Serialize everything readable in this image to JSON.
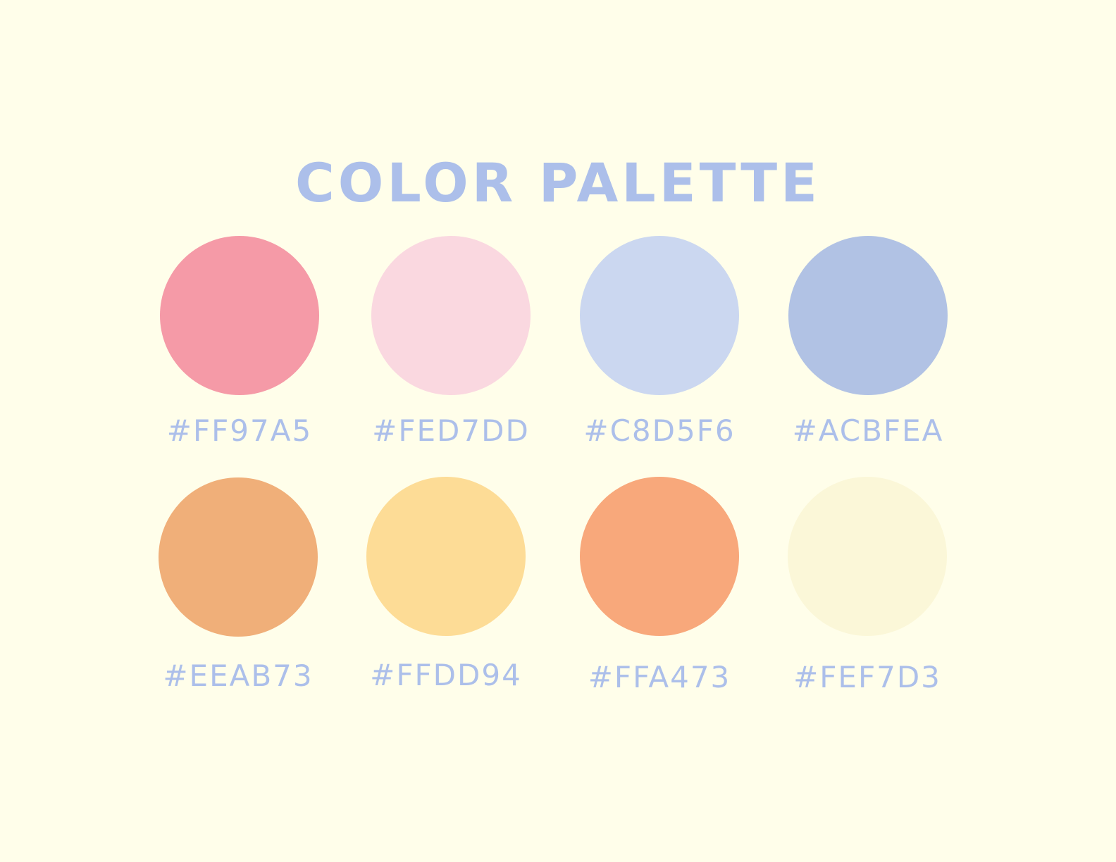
{
  "title": "COLOR PALETTE",
  "colors": {
    "background": "#FFFEEA",
    "text": "#ACBFEA"
  },
  "swatches": [
    {
      "label": "#FF97A5",
      "color": "#F59AA7"
    },
    {
      "label": "#FED7DD",
      "color": "#FAD8E0"
    },
    {
      "label": "#C8D5F6",
      "color": "#CBD7F0"
    },
    {
      "label": "#ACBFEA",
      "color": "#B1C2E4"
    },
    {
      "label": "#EEAB73",
      "color": "#F0AF79"
    },
    {
      "label": "#FFDD94",
      "color": "#FDDC96"
    },
    {
      "label": "#FFA473",
      "color": "#F8A87B"
    },
    {
      "label": "#FEF7D3",
      "color": "#FBF7D8"
    }
  ]
}
